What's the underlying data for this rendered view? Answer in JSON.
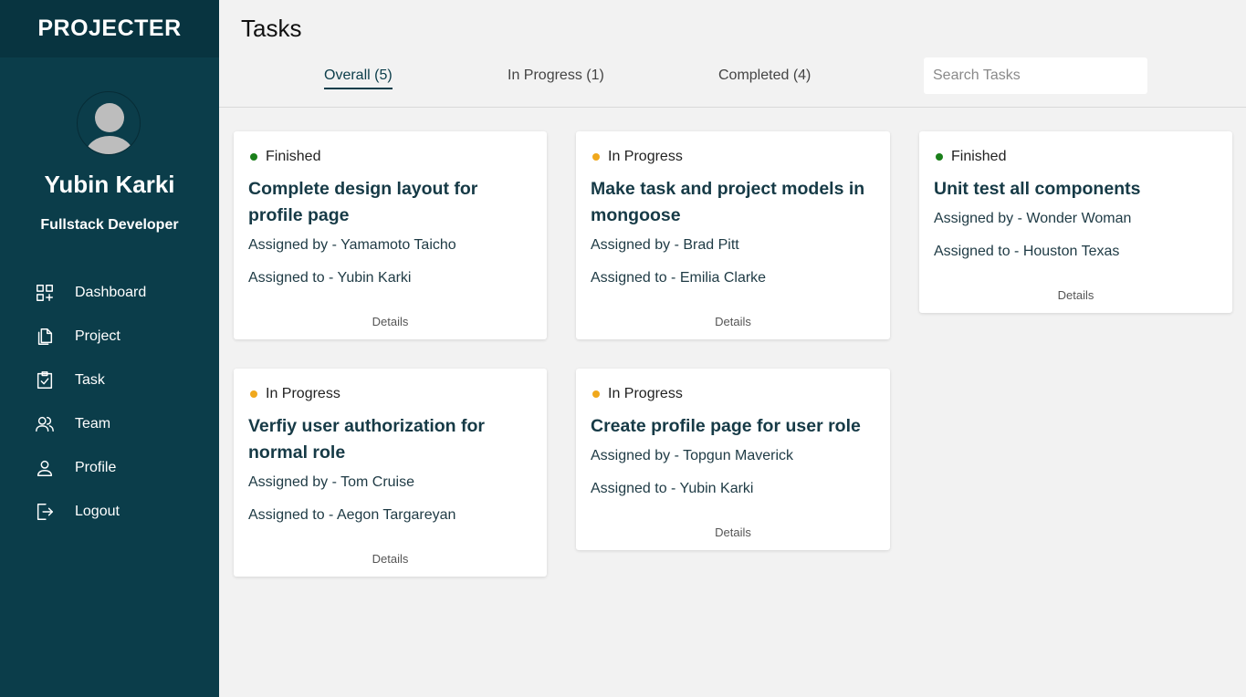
{
  "app": {
    "brand": "PROJECTER"
  },
  "user": {
    "name": "Yubin Karki",
    "role": "Fullstack Developer"
  },
  "nav": [
    {
      "label": "Dashboard",
      "icon": "dashboard-icon"
    },
    {
      "label": "Project",
      "icon": "documents-icon"
    },
    {
      "label": "Task",
      "icon": "clipboard-check-icon"
    },
    {
      "label": "Team",
      "icon": "team-icon"
    },
    {
      "label": "Profile",
      "icon": "person-icon"
    },
    {
      "label": "Logout",
      "icon": "logout-icon"
    }
  ],
  "page": {
    "title": "Tasks"
  },
  "tabs": [
    {
      "label": "Overall (5)",
      "active": true
    },
    {
      "label": "In Progress (1)",
      "active": false
    },
    {
      "label": "Completed (4)",
      "active": false
    }
  ],
  "search": {
    "placeholder": "Search Tasks",
    "value": ""
  },
  "status_colors": {
    "Finished": "#1a7f1a",
    "In Progress": "#f0a81c"
  },
  "tasks": [
    {
      "status": "Finished",
      "title": "Complete design layout for profile page",
      "assigned_by": "Assigned by - Yamamoto Taicho",
      "assigned_to": "Assigned to - Yubin Karki",
      "details": "Details"
    },
    {
      "status": "In Progress",
      "title": "Make task and project models in mongoose",
      "assigned_by": "Assigned by - Brad Pitt",
      "assigned_to": "Assigned to - Emilia Clarke",
      "details": "Details"
    },
    {
      "status": "Finished",
      "title": "Unit test all components",
      "assigned_by": "Assigned by - Wonder Woman",
      "assigned_to": "Assigned to - Houston Texas",
      "details": "Details"
    },
    {
      "status": "In Progress",
      "title": "Verfiy user authorization for normal role",
      "assigned_by": "Assigned by - Tom Cruise",
      "assigned_to": "Assigned to - Aegon Targareyan",
      "details": "Details"
    },
    {
      "status": "In Progress",
      "title": "Create profile page for user role",
      "assigned_by": "Assigned by - Topgun Maverick",
      "assigned_to": "Assigned to - Yubin Karki",
      "details": "Details"
    }
  ]
}
